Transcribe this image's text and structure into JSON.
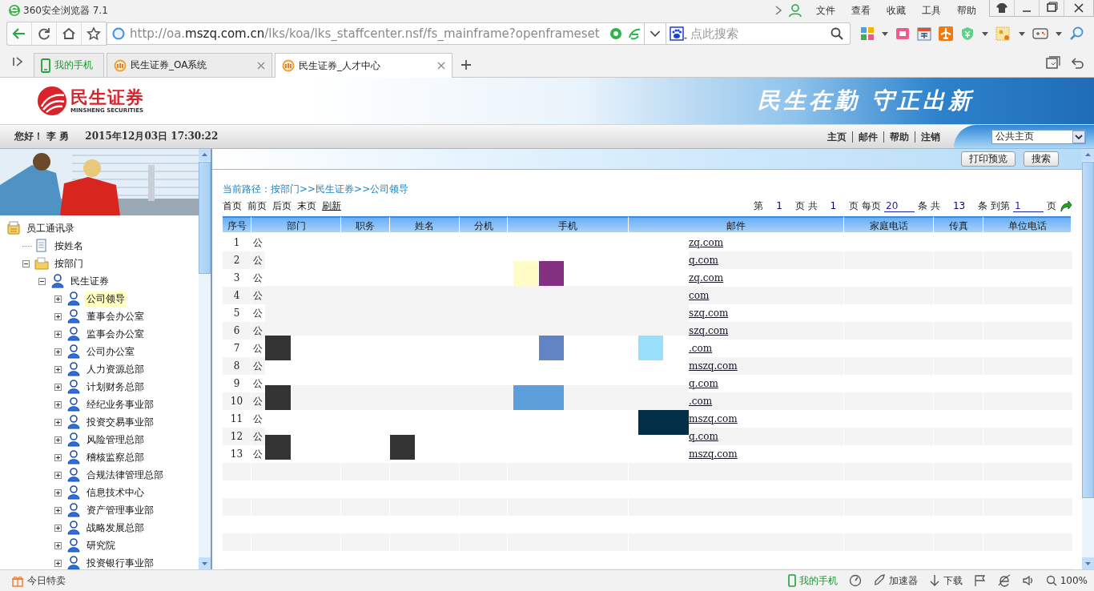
{
  "browser": {
    "title": "360安全浏览器 7.1",
    "menu": [
      "文件",
      "查看",
      "收藏",
      "工具",
      "帮助"
    ],
    "address": {
      "prefix": "http://oa.",
      "host": "mszq.com.cn",
      "path": "/lks/koa/lks_staffcenter.nsf/fs_mainframe?openframeset"
    },
    "search": {
      "placeholder": "点此搜索"
    },
    "tabs": [
      {
        "label": "我的手机",
        "kind": "phone",
        "selected": false
      },
      {
        "label": "民生证券_OA系统",
        "kind": "page",
        "selected": false
      },
      {
        "label": "民生证券_人才中心",
        "kind": "page",
        "selected": true
      }
    ]
  },
  "header": {
    "logo_text": "民生证券",
    "logo_subtext": "MINSHENG SECURITIES",
    "slogan": "民生在勤 守正出新"
  },
  "nav": {
    "greeting": "您好！ 李 勇",
    "datetime": "2015年12月03日  17:30:22",
    "links": [
      "主页",
      "邮件",
      "帮助",
      "注销"
    ],
    "homepage_select": "公共主页"
  },
  "sidebar": {
    "tree": [
      {
        "label": "员工通讯录",
        "kind": "book",
        "selected": false,
        "children": [
          {
            "label": "按姓名",
            "kind": "doc",
            "selected": false
          },
          {
            "label": "按部门",
            "kind": "folder",
            "expanded": true,
            "selected": false,
            "children": [
              {
                "label": "民生证券",
                "kind": "group",
                "expanded": true,
                "selected": false,
                "children": [
                  {
                    "label": "公司领导",
                    "kind": "group",
                    "expanded": false,
                    "selected": true
                  },
                  {
                    "label": "董事会办公室",
                    "kind": "group",
                    "expanded": false,
                    "selected": false
                  },
                  {
                    "label": "监事会办公室",
                    "kind": "group",
                    "expanded": false,
                    "selected": false
                  },
                  {
                    "label": "公司办公室",
                    "kind": "group",
                    "expanded": false,
                    "selected": false
                  },
                  {
                    "label": "人力资源总部",
                    "kind": "group",
                    "expanded": false,
                    "selected": false
                  },
                  {
                    "label": "计划财务总部",
                    "kind": "group",
                    "expanded": false,
                    "selected": false
                  },
                  {
                    "label": "经纪业务事业部",
                    "kind": "group",
                    "expanded": false,
                    "selected": false
                  },
                  {
                    "label": "投资交易事业部",
                    "kind": "group",
                    "expanded": false,
                    "selected": false
                  },
                  {
                    "label": "风险管理总部",
                    "kind": "group",
                    "expanded": false,
                    "selected": false
                  },
                  {
                    "label": "稽核监察总部",
                    "kind": "group",
                    "expanded": false,
                    "selected": false
                  },
                  {
                    "label": "合规法律管理总部",
                    "kind": "group",
                    "expanded": false,
                    "selected": false
                  },
                  {
                    "label": "信息技术中心",
                    "kind": "group",
                    "expanded": false,
                    "selected": false
                  },
                  {
                    "label": "资产管理事业部",
                    "kind": "group",
                    "expanded": false,
                    "selected": false
                  },
                  {
                    "label": "战略发展总部",
                    "kind": "group",
                    "expanded": false,
                    "selected": false
                  },
                  {
                    "label": "研究院",
                    "kind": "group",
                    "expanded": false,
                    "selected": false
                  },
                  {
                    "label": "投资银行事业部",
                    "kind": "group",
                    "expanded": false,
                    "selected": false
                  }
                ]
              }
            ]
          }
        ]
      }
    ]
  },
  "toolbar": {
    "buttons": [
      "打印预览",
      "搜索"
    ]
  },
  "breadcrumb": "当前路径：按部门>>民生证券>>公司领导",
  "pager": {
    "links": [
      {
        "label": "首页",
        "kind": "plain"
      },
      {
        "label": "前页",
        "kind": "plain"
      },
      {
        "label": "后页",
        "kind": "plain"
      },
      {
        "label": "末页",
        "kind": "plain"
      },
      {
        "label": "刷新",
        "kind": "underlined"
      }
    ],
    "info": [
      {
        "kind": "label",
        "text": "第"
      },
      {
        "kind": "number",
        "text": "1"
      },
      {
        "kind": "label",
        "text": "页 共"
      },
      {
        "kind": "number",
        "text": "1"
      },
      {
        "kind": "label",
        "text": "页 每页"
      },
      {
        "kind": "input",
        "text": "20"
      },
      {
        "kind": "label",
        "text": "条 共"
      },
      {
        "kind": "number",
        "text": "13"
      },
      {
        "kind": "label",
        "text": "条 到第"
      },
      {
        "kind": "input",
        "text": "1"
      },
      {
        "kind": "label",
        "text": "页"
      },
      {
        "kind": "go"
      }
    ]
  },
  "table": {
    "columns": [
      "序号",
      "部门",
      "职务",
      "姓名",
      "分机",
      "手机",
      "邮件",
      "家庭电话",
      "传真",
      "单位电话"
    ],
    "rows": [
      {
        "no": "1",
        "department": "公",
        "email": "zq.com"
      },
      {
        "no": "2",
        "department": "公",
        "email": "q.com"
      },
      {
        "no": "3",
        "department": "公",
        "email": "zq.com"
      },
      {
        "no": "4",
        "department": "公",
        "email": "com"
      },
      {
        "no": "5",
        "department": "公",
        "email": "szq.com"
      },
      {
        "no": "6",
        "department": "公",
        "email": "szq.com"
      },
      {
        "no": "7",
        "department": "公",
        "email": ".com"
      },
      {
        "no": "8",
        "department": "公",
        "email": "mszq.com"
      },
      {
        "no": "9",
        "department": "公",
        "email": "q.com"
      },
      {
        "no": "10",
        "department": "公",
        "email": ".com"
      },
      {
        "no": "11",
        "department": "公",
        "email": "mszq.com"
      },
      {
        "no": "12",
        "department": "公",
        "email": "q.com"
      },
      {
        "no": "13",
        "department": "公",
        "email": "mszq.com"
      }
    ]
  },
  "status_bar": {
    "left": "今日特卖",
    "phone": "我的手机",
    "accelerator": "加速器",
    "download": "下载",
    "zoom": "100%"
  }
}
